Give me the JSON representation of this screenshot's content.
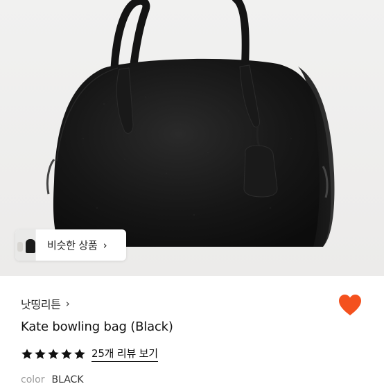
{
  "product_image": {
    "alt": "Kate bowling bag (Black)"
  },
  "similar_products": {
    "label": "비슷한 상품",
    "chevron": "chevron-right-icon"
  },
  "seller": {
    "name": "낫띵리튼",
    "chevron": "chevron-right-icon"
  },
  "favorite": {
    "icon": "heart-icon",
    "color": "#f4511e"
  },
  "product": {
    "title": "Kate bowling bag (Black)"
  },
  "rating": {
    "stars": 5,
    "max_stars": 5,
    "star_color": "#111111",
    "review_link": "25개 리뷰 보기"
  },
  "option": {
    "key": "color",
    "value": "BLACK"
  }
}
